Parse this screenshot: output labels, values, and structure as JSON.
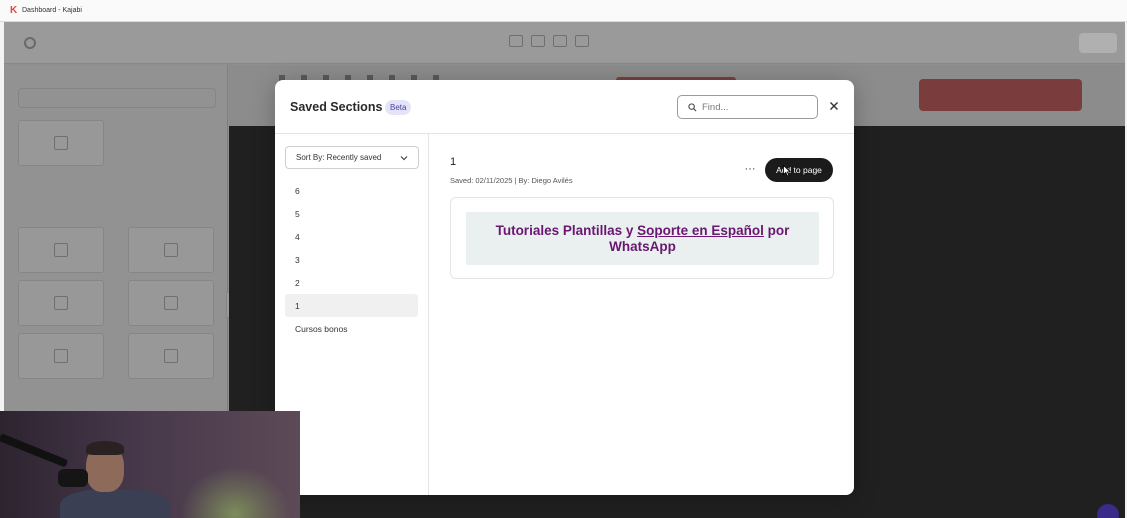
{
  "browser": {
    "tab_title": "Dashboard - Kajabi"
  },
  "modal": {
    "title": "Saved Sections",
    "badge": "Beta",
    "search_placeholder": "Find...",
    "sort_label": "Sort By: Recently saved",
    "sections": [
      {
        "label": "6",
        "active": false
      },
      {
        "label": "5",
        "active": false
      },
      {
        "label": "4",
        "active": false
      },
      {
        "label": "3",
        "active": false
      },
      {
        "label": "2",
        "active": false
      },
      {
        "label": "1",
        "active": true
      },
      {
        "label": "Cursos bonos",
        "active": false
      }
    ],
    "selected": {
      "name": "1",
      "meta": "Saved: 02/11/2025 | By: Diego Avilés",
      "more_label": "···",
      "add_label": "Add to page",
      "preview": {
        "line1_a": "Tutoriales Plantillas y ",
        "line1_link": "Soporte en Español",
        "line1_b": " por",
        "line2": "WhatsApp"
      }
    }
  },
  "colors": {
    "accent_purple": "#6a1672",
    "beta_bg": "#e5e4f7",
    "button_dark": "#1b1b1b"
  }
}
